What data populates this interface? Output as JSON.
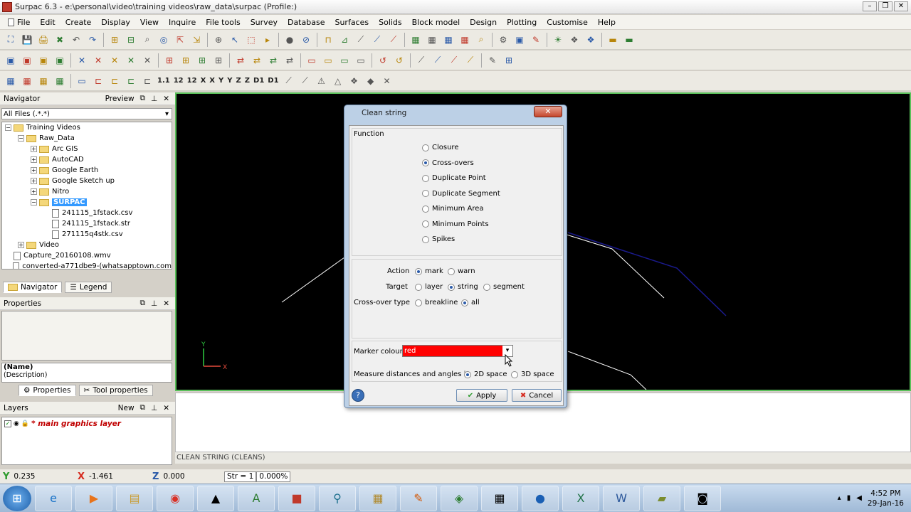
{
  "window": {
    "title": "Surpac 6.3 - e:\\personal\\video\\training videos\\raw_data\\surpac (Profile:)"
  },
  "menu": [
    "File",
    "Edit",
    "Create",
    "Display",
    "View",
    "Inquire",
    "File tools",
    "Survey",
    "Database",
    "Surfaces",
    "Solids",
    "Block model",
    "Design",
    "Plotting",
    "Customise",
    "Help"
  ],
  "toolbar3_text": [
    "1.1",
    "12",
    "12",
    "X",
    "X",
    "Y",
    "Y",
    "Z",
    "Z",
    "D1",
    "D1"
  ],
  "navigator": {
    "title": "Navigator",
    "preview_label": "Preview",
    "filter": "All Files (.*.*)",
    "tree": [
      {
        "label": "Training Videos",
        "indent": 0,
        "kind": "folder",
        "exp": "-"
      },
      {
        "label": "Raw_Data",
        "indent": 1,
        "kind": "folder",
        "exp": "-"
      },
      {
        "label": "Arc GIS",
        "indent": 2,
        "kind": "folder",
        "exp": "+"
      },
      {
        "label": "AutoCAD",
        "indent": 2,
        "kind": "folder",
        "exp": "+"
      },
      {
        "label": "Google Earth",
        "indent": 2,
        "kind": "folder",
        "exp": "+"
      },
      {
        "label": "Google Sketch up",
        "indent": 2,
        "kind": "folder",
        "exp": "+"
      },
      {
        "label": "Nitro",
        "indent": 2,
        "kind": "folder",
        "exp": "+"
      },
      {
        "label": "SURPAC",
        "indent": 2,
        "kind": "folder",
        "exp": "-",
        "selected": true
      },
      {
        "label": "241115_1fstack.csv",
        "indent": 3,
        "kind": "doc"
      },
      {
        "label": "241115_1fstack.str",
        "indent": 3,
        "kind": "doc"
      },
      {
        "label": "271115q4stk.csv",
        "indent": 3,
        "kind": "doc"
      },
      {
        "label": "Video",
        "indent": 1,
        "kind": "folder",
        "exp": "+"
      },
      {
        "label": "Capture_20160108.wmv",
        "indent": 0,
        "kind": "doc"
      },
      {
        "label": "converted-a771dbe9-(whatsapptown.com",
        "indent": 0,
        "kind": "doc"
      }
    ],
    "tabs": [
      "Navigator",
      "Legend"
    ]
  },
  "properties": {
    "title": "Properties",
    "name": "(Name)",
    "description": "(Description)",
    "tabs": [
      "Properties",
      "Tool properties"
    ]
  },
  "layers": {
    "title": "Layers",
    "new_label": "New",
    "items": [
      "* main graphics layer"
    ]
  },
  "dialog": {
    "title": "Clean string",
    "function_label": "Function",
    "functions": [
      "Closure",
      "Cross-overs",
      "Duplicate Point",
      "Duplicate Segment",
      "Minimum Area",
      "Minimum Points",
      "Spikes"
    ],
    "selected_function": "Cross-overs",
    "action_label": "Action",
    "action_options": [
      "mark",
      "warn"
    ],
    "target_label": "Target",
    "target_options": [
      "layer",
      "string",
      "segment"
    ],
    "crossover_label": "Cross-over type",
    "crossover_options": [
      "breakline",
      "all"
    ],
    "marker_colour_label": "Marker colour",
    "marker_colour_value": "red",
    "measure_label": "Measure distances and angles in",
    "measure_options": [
      "2D space",
      "3D space"
    ],
    "apply_label": "Apply",
    "cancel_label": "Cancel",
    "accent_colors": {
      "marker": "#ff0000"
    }
  },
  "command_status": "CLEAN STRING (CLEANS)",
  "status": {
    "y_value": "0.235",
    "x_value": "-1.461",
    "z_value": "0.000",
    "str_label": "Str = 1",
    "str_percent": "0.000%"
  },
  "taskbar": {
    "time": "4:52 PM",
    "date": "29-Jan-16"
  },
  "gizmo": {
    "y_label": "Y",
    "x_label": "X"
  }
}
